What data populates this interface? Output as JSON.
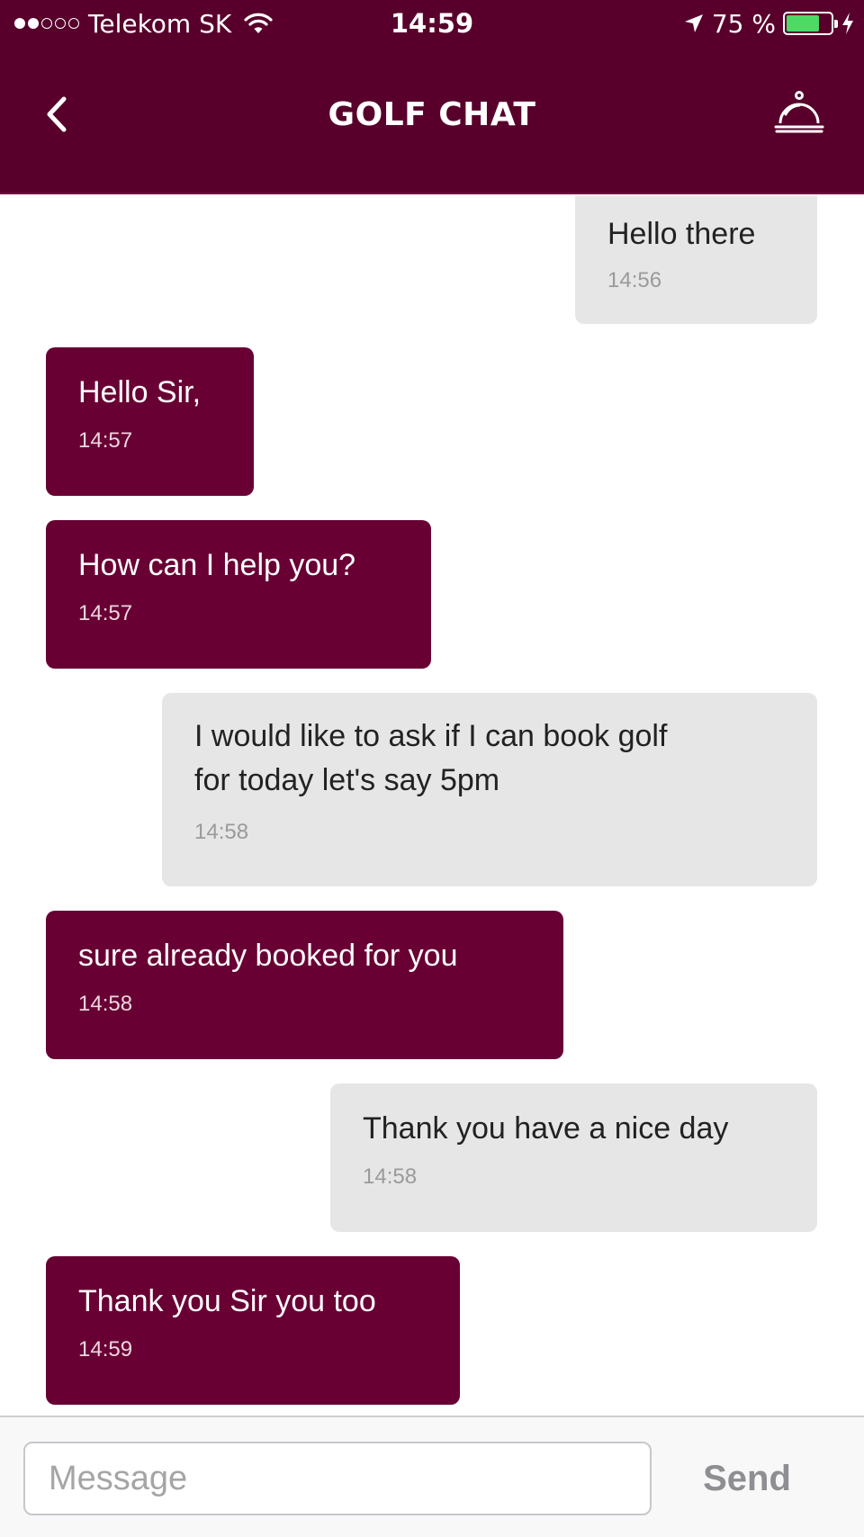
{
  "status_bar": {
    "carrier": "Telekom SK",
    "time": "14:59",
    "battery_percent": "75 %",
    "battery_level": 0.75,
    "signal_bars": 2,
    "signal_total": 5
  },
  "header": {
    "title": "GOLF CHAT",
    "back_icon": "chevron-left-icon",
    "service_icon": "concierge-bell-icon",
    "background": "#58002b"
  },
  "messages": [
    {
      "direction": "out",
      "text": "Hello there",
      "time": "14:56"
    },
    {
      "direction": "in",
      "text": "Hello Sir,",
      "time": "14:57"
    },
    {
      "direction": "in",
      "text": "How can I help you?",
      "time": "14:57"
    },
    {
      "direction": "out",
      "text": "I would like to ask if I can book golf\nfor today let's say 5pm",
      "time": "14:58"
    },
    {
      "direction": "in",
      "text": "sure already booked for you",
      "time": "14:58"
    },
    {
      "direction": "out",
      "text": "Thank you have a nice day",
      "time": "14:58"
    },
    {
      "direction": "in",
      "text": "Thank you Sir you too",
      "time": "14:59"
    }
  ],
  "composer": {
    "placeholder": "Message",
    "value": "",
    "send_label": "Send"
  },
  "colors": {
    "incoming_bubble": "#690034",
    "outgoing_bubble": "#e6e6e6",
    "battery": "#4cd964"
  }
}
